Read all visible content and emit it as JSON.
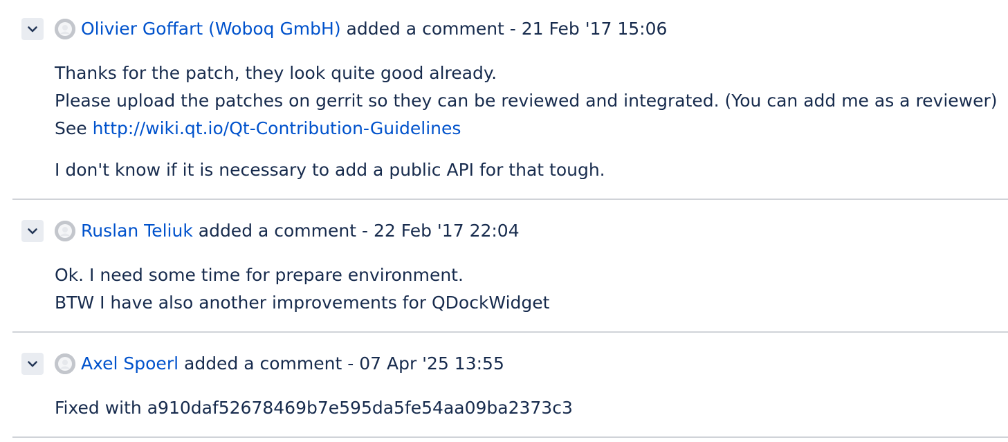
{
  "comments": [
    {
      "author": "Olivier Goffart (Woboq GmbH)",
      "action": "added a comment",
      "separator": " - ",
      "timestamp": "21 Feb '17 15:06",
      "line1": "Thanks for the patch, they look quite good already.",
      "line2": "Please upload the patches on gerrit so they can be reviewed and integrated. (You can add me as a reviewer)",
      "line3_prefix": "See ",
      "line3_link": "http://wiki.qt.io/Qt-Contribution-Guidelines",
      "para2": "I don't know if it is necessary to add a public API for that tough."
    },
    {
      "author": "Ruslan Teliuk",
      "action": "added a comment",
      "separator": " - ",
      "timestamp": "22 Feb '17 22:04",
      "line1": "Ok. I need some time for prepare environment.",
      "line2": "BTW I have also another improvements for QDockWidget"
    },
    {
      "author": "Axel Spoerl",
      "action": "added a comment",
      "separator": " - ",
      "timestamp": "07 Apr '25 13:55",
      "line1": "Fixed with a910daf52678469b7e595da5fe54aa09ba2373c3"
    }
  ],
  "icons": {
    "toggle": "chevron-down-icon",
    "avatar": "default-avatar-icon"
  },
  "colors": {
    "link": "#0052cc",
    "text": "#172b4d",
    "toggle_bg": "#e9ecf1",
    "avatar_bg": "#c3c6cc",
    "divider": "#d0d3d8"
  }
}
